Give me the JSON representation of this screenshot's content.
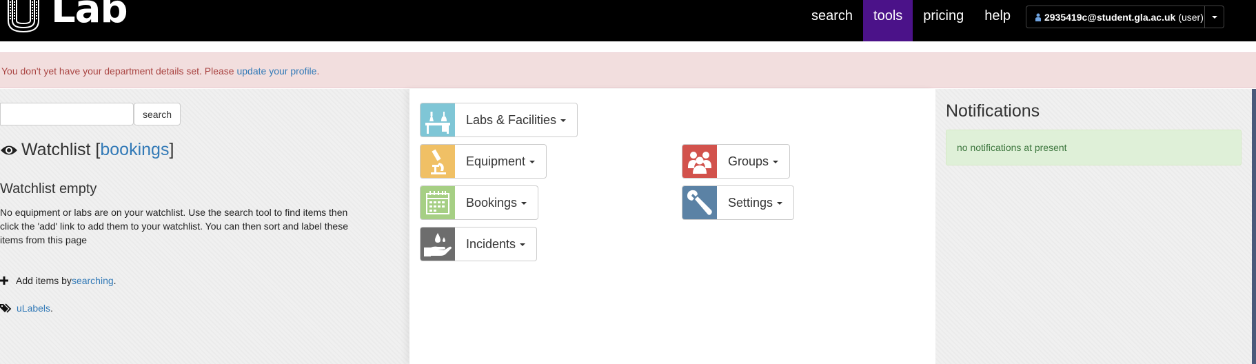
{
  "app": {
    "logo_text": "Lab"
  },
  "nav": {
    "items": [
      {
        "label": "search"
      },
      {
        "label": "tools"
      },
      {
        "label": "pricing"
      },
      {
        "label": "help"
      }
    ],
    "active": "tools"
  },
  "user": {
    "email": "2935419c@student.gla.ac.uk",
    "role": "(user)"
  },
  "alert": {
    "text": "You don't yet have your department details set. Please ",
    "link": "update your profile",
    "suffix": "."
  },
  "search": {
    "value": "",
    "button_label": "search"
  },
  "watchlist": {
    "title": "Watchlist [",
    "link": "bookings",
    "title_end": "]",
    "empty_title": "Watchlist empty",
    "empty_text": "No equipment or labs are on your watchlist. Use the search tool to find items then click the 'add' link to add them to your watchlist. You can then sort and label these items from this page",
    "add_prefix": "Add items by ",
    "add_link": "searching",
    "add_suffix": ".",
    "labels_link": "uLabels",
    "labels_suffix": "."
  },
  "tools": [
    {
      "label": "Labs & Facilities",
      "icon": "labs-icon",
      "color": "#7fc6d6"
    },
    {
      "label": "Equipment",
      "icon": "microscope-icon",
      "color": "#f0c065"
    },
    {
      "label": "Groups",
      "icon": "groups-icon",
      "color": "#d2524c"
    },
    {
      "label": "Bookings",
      "icon": "calendar-icon",
      "color": "#a6cf84"
    },
    {
      "label": "Settings",
      "icon": "wrench-icon",
      "color": "#5b82a5"
    },
    {
      "label": "Incidents",
      "icon": "incident-hand-icon",
      "color": "#6d6d6d"
    }
  ],
  "notifications": {
    "title": "Notifications",
    "empty": "no notifications at present"
  },
  "colors": {
    "topbar": "#000000",
    "nav_active": "#4b1289",
    "link": "#337ab7",
    "alert_bg": "#f2dede",
    "notif_bg": "#dff0d8"
  }
}
